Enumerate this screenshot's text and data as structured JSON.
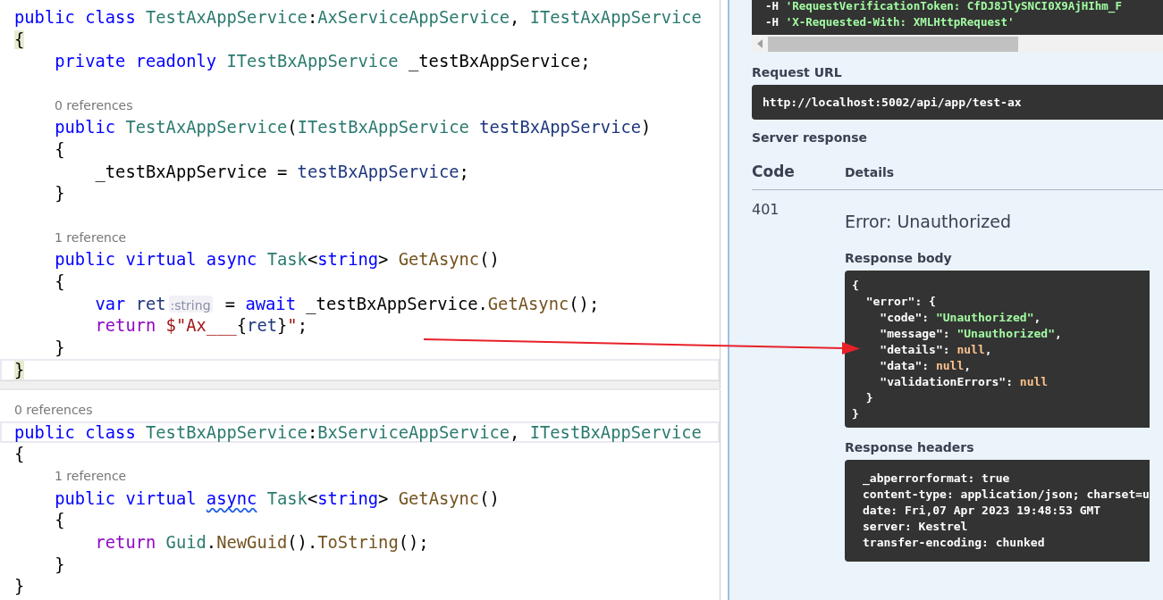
{
  "editor_panes": [
    {
      "lines": [
        {
          "kind": "code",
          "current": false,
          "tokens": [
            {
              "t": "public class ",
              "kind": "kw"
            },
            {
              "t": "TestAxAppService",
              "kind": "type"
            },
            {
              "t": ":",
              "kind": "plain"
            },
            {
              "t": "AxServiceAppService",
              "kind": "type"
            },
            {
              "t": ", ",
              "kind": "plain"
            },
            {
              "t": "ITestAxAppService",
              "kind": "type"
            }
          ]
        },
        {
          "kind": "code",
          "current": false,
          "tokens": [
            {
              "t": "{",
              "kind": "brace"
            }
          ]
        },
        {
          "kind": "code",
          "current": false,
          "tokens": [
            {
              "t": "    private readonly ",
              "kind": "kw"
            },
            {
              "t": "ITestBxAppService",
              "kind": "type"
            },
            {
              "t": " _testBxAppService;",
              "kind": "plain"
            }
          ]
        },
        {
          "kind": "blank",
          "current": false
        },
        {
          "kind": "lens",
          "current": false,
          "text": "0 references"
        },
        {
          "kind": "code",
          "current": false,
          "tokens": [
            {
              "t": "    public ",
              "kind": "kw"
            },
            {
              "t": "TestAxAppService",
              "kind": "type"
            },
            {
              "t": "(",
              "kind": "plain"
            },
            {
              "t": "ITestBxAppService",
              "kind": "type"
            },
            {
              "t": " testBxAppService",
              "kind": "param"
            },
            {
              "t": ")",
              "kind": "plain"
            }
          ]
        },
        {
          "kind": "code",
          "current": false,
          "tokens": [
            {
              "t": "    {",
              "kind": "plain"
            }
          ]
        },
        {
          "kind": "code",
          "current": false,
          "tokens": [
            {
              "t": "        _testBxAppService = ",
              "kind": "plain"
            },
            {
              "t": "testBxAppService",
              "kind": "param"
            },
            {
              "t": ";",
              "kind": "plain"
            }
          ]
        },
        {
          "kind": "code",
          "current": false,
          "tokens": [
            {
              "t": "    }",
              "kind": "plain"
            }
          ]
        },
        {
          "kind": "blank",
          "current": false
        },
        {
          "kind": "lens",
          "current": false,
          "text": "1 reference"
        },
        {
          "kind": "code",
          "current": false,
          "tokens": [
            {
              "t": "    public virtual async ",
              "kind": "kw"
            },
            {
              "t": "Task",
              "kind": "type"
            },
            {
              "t": "<",
              "kind": "plain"
            },
            {
              "t": "string",
              "kind": "kw"
            },
            {
              "t": "> ",
              "kind": "plain"
            },
            {
              "t": "GetAsync",
              "kind": "method"
            },
            {
              "t": "()",
              "kind": "plain"
            }
          ]
        },
        {
          "kind": "code",
          "current": false,
          "tokens": [
            {
              "t": "    {",
              "kind": "plain"
            }
          ]
        },
        {
          "kind": "code",
          "current": false,
          "tokens": [
            {
              "t": "        var ",
              "kind": "kw"
            },
            {
              "t": "ret",
              "kind": "param"
            },
            {
              "t": ":string",
              "kind": "hint"
            },
            {
              "t": " = ",
              "kind": "plain"
            },
            {
              "t": "await ",
              "kind": "kw"
            },
            {
              "t": "_testBxAppService.",
              "kind": "plain"
            },
            {
              "t": "GetAsync",
              "kind": "method"
            },
            {
              "t": "();",
              "kind": "plain"
            }
          ]
        },
        {
          "kind": "code",
          "current": false,
          "tokens": [
            {
              "t": "        return ",
              "kind": "ctrl"
            },
            {
              "t": "$\"Ax___",
              "kind": "string"
            },
            {
              "t": "{",
              "kind": "plain"
            },
            {
              "t": "ret",
              "kind": "param"
            },
            {
              "t": "}",
              "kind": "plain"
            },
            {
              "t": "\"",
              "kind": "string"
            },
            {
              "t": ";",
              "kind": "plain"
            }
          ]
        },
        {
          "kind": "code",
          "current": false,
          "tokens": [
            {
              "t": "    }",
              "kind": "plain"
            }
          ]
        },
        {
          "kind": "code",
          "current": true,
          "tokens": [
            {
              "t": "}",
              "kind": "brace"
            }
          ]
        }
      ]
    },
    {
      "lines": [
        {
          "kind": "lens",
          "current": false,
          "text": "0 references"
        },
        {
          "kind": "code",
          "current": true,
          "tokens": [
            {
              "t": "public class ",
              "kind": "kw"
            },
            {
              "t": "TestBxAppService",
              "kind": "type"
            },
            {
              "t": ":",
              "kind": "plain"
            },
            {
              "t": "BxServiceAppService",
              "kind": "type"
            },
            {
              "t": ", ",
              "kind": "plain"
            },
            {
              "t": "ITestBxAppService",
              "kind": "type"
            }
          ]
        },
        {
          "kind": "code",
          "current": false,
          "tokens": [
            {
              "t": "{",
              "kind": "plain"
            }
          ]
        },
        {
          "kind": "lens",
          "current": false,
          "text": "1 reference"
        },
        {
          "kind": "code",
          "current": false,
          "tokens": [
            {
              "t": "    public virtual ",
              "kind": "kw"
            },
            {
              "t": "async",
              "kind": "squiggle"
            },
            {
              "t": " Task",
              "kind": "type"
            },
            {
              "t": "<",
              "kind": "plain"
            },
            {
              "t": "string",
              "kind": "kw"
            },
            {
              "t": "> ",
              "kind": "plain"
            },
            {
              "t": "GetAsync",
              "kind": "method"
            },
            {
              "t": "()",
              "kind": "plain"
            }
          ]
        },
        {
          "kind": "code",
          "current": false,
          "tokens": [
            {
              "t": "    {",
              "kind": "plain"
            }
          ]
        },
        {
          "kind": "code",
          "current": false,
          "tokens": [
            {
              "t": "        return ",
              "kind": "ctrl"
            },
            {
              "t": "Guid",
              "kind": "type"
            },
            {
              "t": ".",
              "kind": "plain"
            },
            {
              "t": "NewGuid",
              "kind": "method"
            },
            {
              "t": "().",
              "kind": "plain"
            },
            {
              "t": "ToString",
              "kind": "method"
            },
            {
              "t": "();",
              "kind": "plain"
            }
          ]
        },
        {
          "kind": "code",
          "current": false,
          "tokens": [
            {
              "t": "    }",
              "kind": "plain"
            }
          ]
        },
        {
          "kind": "code",
          "current": false,
          "tokens": [
            {
              "t": "}",
              "kind": "plain"
            }
          ]
        }
      ]
    }
  ],
  "response_panel": {
    "curl_lines": [
      [
        {
          "t": "  -H ",
          "kind": "plain"
        },
        {
          "t": "'RequestVerificationToken: CfDJ8JlySNCI0X9AjHIhm_F",
          "kind": "str"
        }
      ],
      [
        {
          "t": "  -H ",
          "kind": "plain"
        },
        {
          "t": "'X-Requested-With: XMLHttpRequest'",
          "kind": "str"
        }
      ]
    ],
    "request_url_label": "Request URL",
    "request_url": "http://localhost:5002/api/app/test-ax",
    "server_response_label": "Server response",
    "columns": [
      "Code",
      "Details"
    ],
    "code": "401",
    "error_title": "Error: Unauthorized",
    "response_body_label": "Response body",
    "response_body": [
      [
        {
          "t": "{",
          "kind": "plain"
        }
      ],
      [
        {
          "t": "  \"error\": {",
          "kind": "plain"
        }
      ],
      [
        {
          "t": "    \"code\": ",
          "kind": "plain"
        },
        {
          "t": "\"Unauthorized\"",
          "kind": "str"
        },
        {
          "t": ",",
          "kind": "plain"
        }
      ],
      [
        {
          "t": "    \"message\": ",
          "kind": "plain"
        },
        {
          "t": "\"Unauthorized\"",
          "kind": "str"
        },
        {
          "t": ",",
          "kind": "plain"
        }
      ],
      [
        {
          "t": "    \"details\": ",
          "kind": "plain"
        },
        {
          "t": "null",
          "kind": "null"
        },
        {
          "t": ",",
          "kind": "plain"
        }
      ],
      [
        {
          "t": "    \"data\": ",
          "kind": "plain"
        },
        {
          "t": "null",
          "kind": "null"
        },
        {
          "t": ",",
          "kind": "plain"
        }
      ],
      [
        {
          "t": "    \"validationErrors\": ",
          "kind": "plain"
        },
        {
          "t": "null",
          "kind": "null"
        }
      ],
      [
        {
          "t": "  }",
          "kind": "plain"
        }
      ],
      [
        {
          "t": "}",
          "kind": "plain"
        }
      ]
    ],
    "response_headers_label": "Response headers",
    "response_headers": [
      "_abperrorformat: true",
      "content-type: application/json; charset=u",
      "date: Fri,07 Apr 2023 19:48:53 GMT",
      "server: Kestrel",
      "transfer-encoding: chunked"
    ]
  }
}
